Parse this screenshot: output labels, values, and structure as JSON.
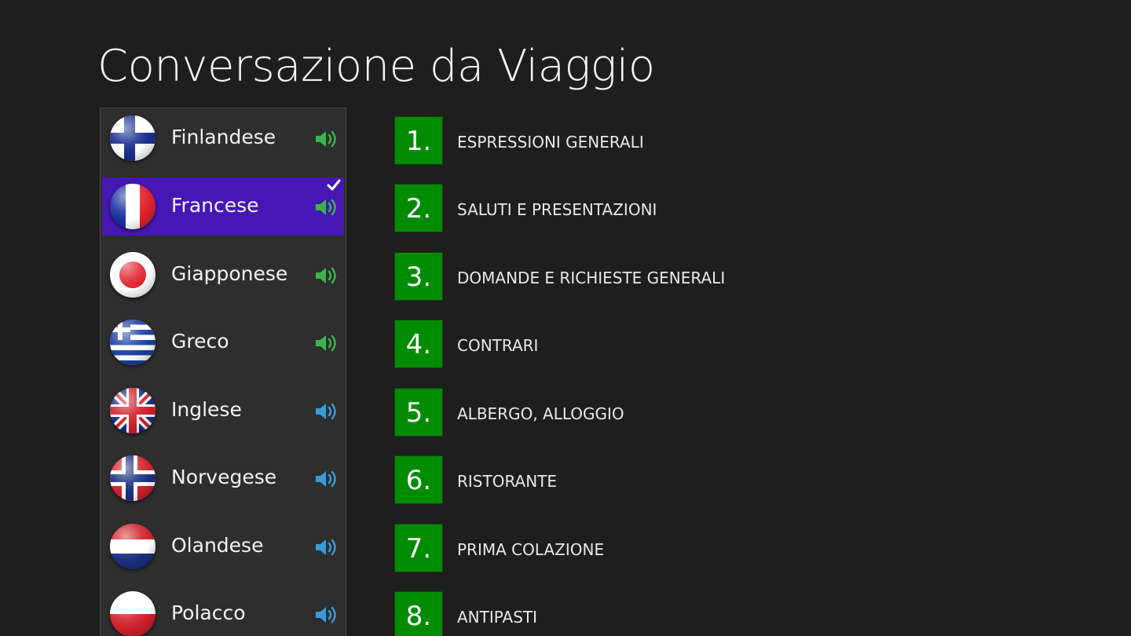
{
  "title": "Conversazione da Viaggio",
  "languages": [
    {
      "name": "Finlandese",
      "flag": "finland-flag",
      "speaker_color": "#3cb44b",
      "selected": false
    },
    {
      "name": "Francese",
      "flag": "france-flag",
      "speaker_color": "#3cb44b",
      "selected": true
    },
    {
      "name": "Giapponese",
      "flag": "japan-flag",
      "speaker_color": "#3cb44b",
      "selected": false
    },
    {
      "name": "Greco",
      "flag": "greece-flag",
      "speaker_color": "#3cb44b",
      "selected": false
    },
    {
      "name": "Inglese",
      "flag": "uk-flag",
      "speaker_color": "#3b9ad9",
      "selected": false
    },
    {
      "name": "Norvegese",
      "flag": "norway-flag",
      "speaker_color": "#3b9ad9",
      "selected": false
    },
    {
      "name": "Olandese",
      "flag": "netherlands-flag",
      "speaker_color": "#3b9ad9",
      "selected": false
    },
    {
      "name": "Polacco",
      "flag": "poland-flag",
      "speaker_color": "#3b9ad9",
      "selected": false
    }
  ],
  "topics": [
    {
      "number": "1.",
      "label": "ESPRESSIONI GENERALI"
    },
    {
      "number": "2.",
      "label": "SALUTI E PRESENTAZIONI"
    },
    {
      "number": "3.",
      "label": "DOMANDE E RICHIESTE GENERALI"
    },
    {
      "number": "4.",
      "label": "CONTRARI"
    },
    {
      "number": "5.",
      "label": "ALBERGO, ALLOGGIO"
    },
    {
      "number": "6.",
      "label": "RISTORANTE"
    },
    {
      "number": "7.",
      "label": "PRIMA COLAZIONE"
    },
    {
      "number": "8.",
      "label": "ANTIPASTI"
    }
  ],
  "colors": {
    "background": "#1e1e1e",
    "panel": "#2e2e2e",
    "selected": "#4617b4",
    "tile": "#008c00"
  },
  "icons": {
    "speaker": "speaker-icon",
    "check": "checkmark-icon"
  }
}
